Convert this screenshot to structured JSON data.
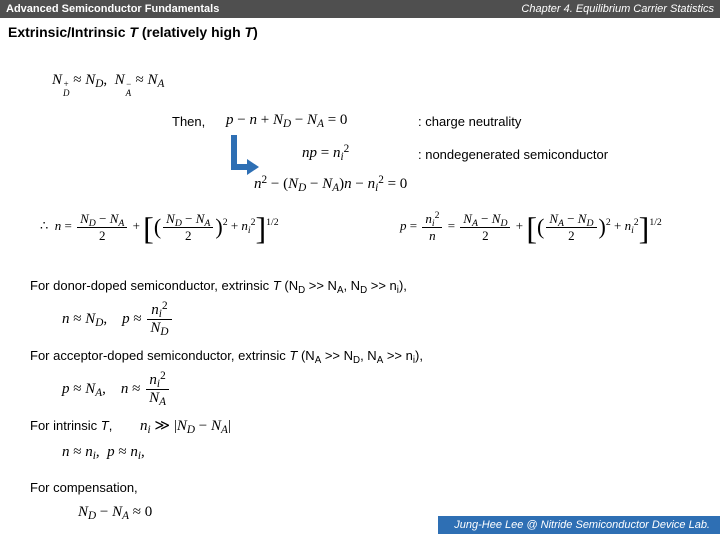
{
  "header": {
    "left": "Advanced Semiconductor Fundamentals",
    "right": "Chapter 4. Equilibrium Carrier Statistics"
  },
  "section": {
    "pre": "Extrinsic/Intrinsic ",
    "var1": "T",
    "mid": " (relatively high ",
    "var2": "T",
    "post": ")"
  },
  "then": "Then,",
  "note_cn": ": charge neutrality",
  "note_np": ": nondegenerated semiconductor",
  "txt_donor": {
    "a": "For donor-doped semiconductor, extrinsic ",
    "b": "T",
    "c": " (N",
    "d": "D",
    "e": " >> N",
    "f": "A",
    "g": ", N",
    "h": "D",
    "i": " >> n",
    "j": "i",
    "k": "),"
  },
  "txt_acceptor": {
    "a": "For acceptor-doped semiconductor, extrinsic ",
    "b": "T",
    "c": " (N",
    "d": "A",
    "e": " >> N",
    "f": "D",
    "g": ", N",
    "h": "A",
    "i": " >> n",
    "j": "i",
    "k": "),"
  },
  "txt_intr": {
    "a": "For intrinsic ",
    "b": "T",
    "c": ","
  },
  "txt_comp": "For compensation,",
  "footer": "Jung-Hee Lee @ Nitride Semiconductor Device Lab.",
  "sym": {
    "ND": "N",
    "ND_s": "D",
    "NA": "N",
    "NA_s": "A",
    "ni": "n",
    "ni_s": "i",
    "approx": "≈",
    "minus": "−",
    "plus": "+",
    "eq": "=",
    "gg": "≫",
    "therefore": "∴",
    "p": "p",
    "n": "n",
    "zero": "0",
    "two": "2",
    "half": "1/2",
    "plus_sup": "+",
    "minus_sup": "−",
    "bar1": "|",
    "bar2": "|",
    "comma": ","
  }
}
